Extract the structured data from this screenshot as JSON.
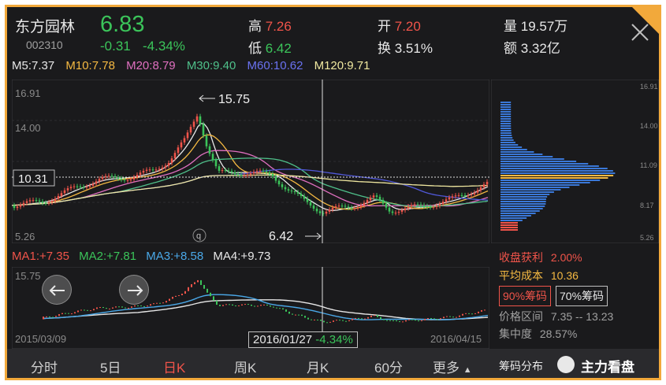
{
  "header": {
    "name": "东方园林",
    "code": "002310",
    "price": "6.83",
    "change": "-0.31",
    "change_pct": "-4.34%",
    "high_label": "高",
    "high": "7.26",
    "low_label": "低",
    "low": "6.42",
    "open_label": "开",
    "open": "7.20",
    "turnover_label": "换",
    "turnover": "3.51%",
    "volume_label": "量",
    "volume": "19.57万",
    "amount_label": "额",
    "amount": "3.32亿"
  },
  "ma_legend": {
    "m5": "M5:7.37",
    "m10": "M10:7.78",
    "m20": "M20:8.79",
    "m30": "M30:9.40",
    "m60": "M60:10.62",
    "m120": "M120:9.71"
  },
  "main_chart": {
    "y_top": "16.91",
    "y_mid": "14.00",
    "y_low": "5.26",
    "cursor_price": "10.31",
    "peak_annotation": "15.75",
    "trough_annotation": "6.42",
    "q_marker": "q"
  },
  "chip_axis": {
    "t1": "16.91",
    "t2": "14.00",
    "t3": "11.09",
    "t4": "8.17",
    "t5": "5.26"
  },
  "sub_legend": {
    "ma1": "MA1:+7.35",
    "ma2": "MA2:+7.81",
    "ma3": "MA3:+8.58",
    "ma4": "MA4:+9.73"
  },
  "sub_chart": {
    "y_top": "15.75",
    "date_start": "2015/03/09",
    "date_end": "2016/04/15",
    "cursor_date": "2016/01/27",
    "cursor_pct": "-4.34%"
  },
  "chip_panel": {
    "profit_label": "收盘获利",
    "profit": "2.00%",
    "avgcost_label": "平均成本",
    "avgcost": "10.36",
    "chip90": "90%筹码",
    "chip70": "70%筹码",
    "range_label": "价格区间",
    "range": "7.35 -- 13.23",
    "concentration_label": "集中度",
    "concentration": "28.57%",
    "dist_label": "筹码分布",
    "watermark": "主力看盘"
  },
  "tabs": [
    "分时",
    "5日",
    "日K",
    "周K",
    "月K",
    "60分",
    "更多"
  ],
  "colors": {
    "accent": "#f2a93b",
    "up": "#f0544a",
    "down": "#3bc45a",
    "m5": "#e8e8e8",
    "m10": "#f5b942",
    "m20": "#e070c0",
    "m30": "#4fc08a",
    "m60": "#5058d8",
    "m120": "#f0e8a0"
  }
}
